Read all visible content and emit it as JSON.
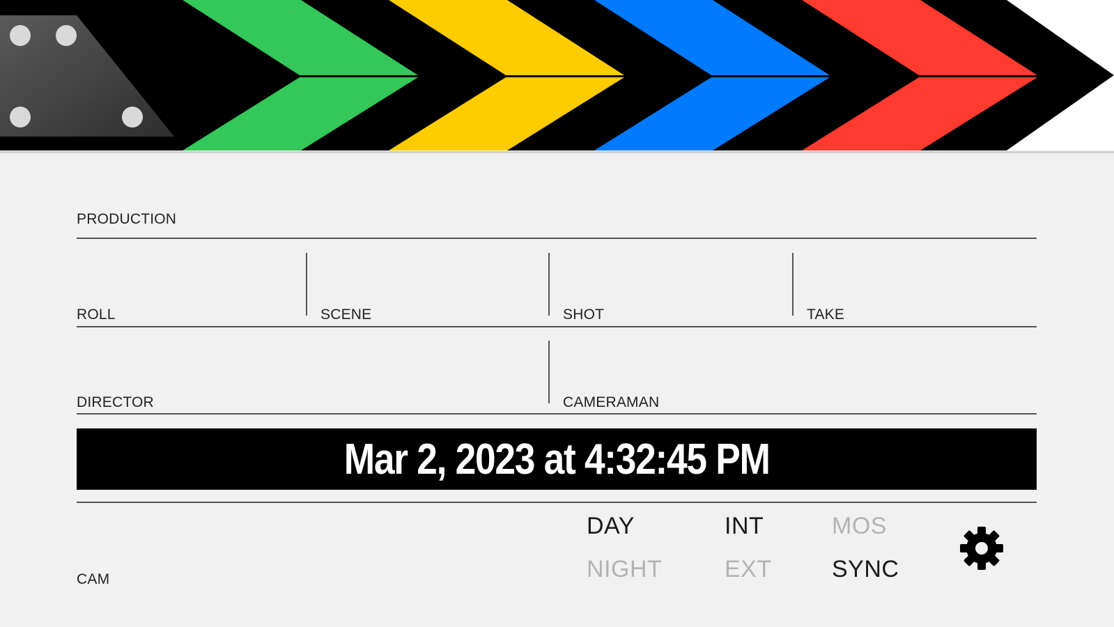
{
  "clapper": {
    "stripe_colors": [
      "#34c759",
      "#ffcc00",
      "#007aff",
      "#ff3b30"
    ],
    "bar_color": "#000000",
    "hinge_color": "#4a4a4a"
  },
  "fields": {
    "production": {
      "label": "PRODUCTION",
      "value": ""
    },
    "roll": {
      "label": "ROLL",
      "value": ""
    },
    "scene": {
      "label": "SCENE",
      "value": ""
    },
    "shot": {
      "label": "SHOT",
      "value": ""
    },
    "take": {
      "label": "TAKE",
      "value": ""
    },
    "director": {
      "label": "DIRECTOR",
      "value": ""
    },
    "cameraman": {
      "label": "CAMERAMAN",
      "value": ""
    },
    "cam": {
      "label": "CAM",
      "value": ""
    }
  },
  "timestamp": "Mar 2, 2023 at 4:32:45 PM",
  "toggles": {
    "day": {
      "label": "DAY",
      "active": true
    },
    "night": {
      "label": "NIGHT",
      "active": false
    },
    "int": {
      "label": "INT",
      "active": true
    },
    "ext": {
      "label": "EXT",
      "active": false
    },
    "mos": {
      "label": "MOS",
      "active": false
    },
    "sync": {
      "label": "SYNC",
      "active": true
    }
  },
  "settings_icon": "gear-icon"
}
